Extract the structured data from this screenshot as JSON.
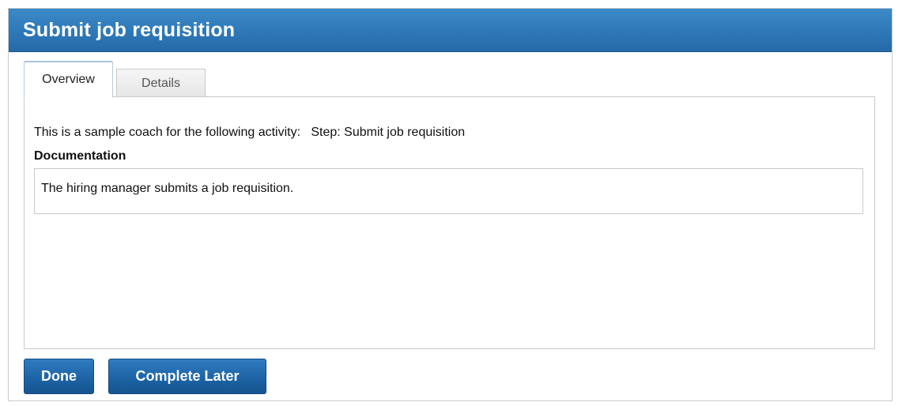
{
  "header": {
    "title": "Submit job requisition"
  },
  "tabs": [
    {
      "label": "Overview",
      "active": true
    },
    {
      "label": "Details",
      "active": false
    }
  ],
  "overview": {
    "intro_text": "This is a sample coach for the following activity:   Step: Submit job requisition",
    "documentation_label": "Documentation",
    "documentation_text": "The hiring manager submits a job requisition."
  },
  "buttons": {
    "done_label": "Done",
    "complete_later_label": "Complete Later"
  },
  "colors": {
    "title_bar": "#2e78b8",
    "button": "#1d64a6"
  }
}
